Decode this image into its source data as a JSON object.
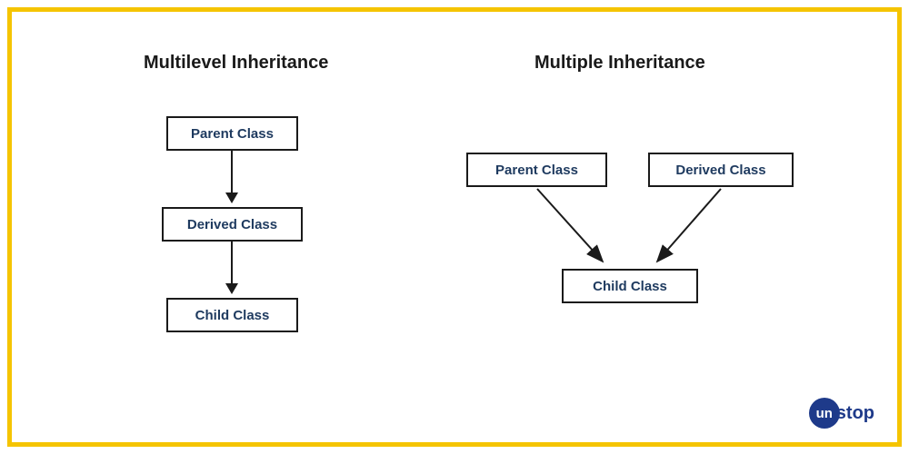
{
  "diagram": {
    "left": {
      "title": "Multilevel Inheritance",
      "boxes": {
        "parent": "Parent Class",
        "derived": "Derived Class",
        "child": "Child Class"
      }
    },
    "right": {
      "title": "Multiple Inheritance",
      "boxes": {
        "parent": "Parent Class",
        "derived": "Derived Class",
        "child": "Child Class"
      }
    }
  },
  "branding": {
    "circle": "un",
    "text": "stop"
  }
}
